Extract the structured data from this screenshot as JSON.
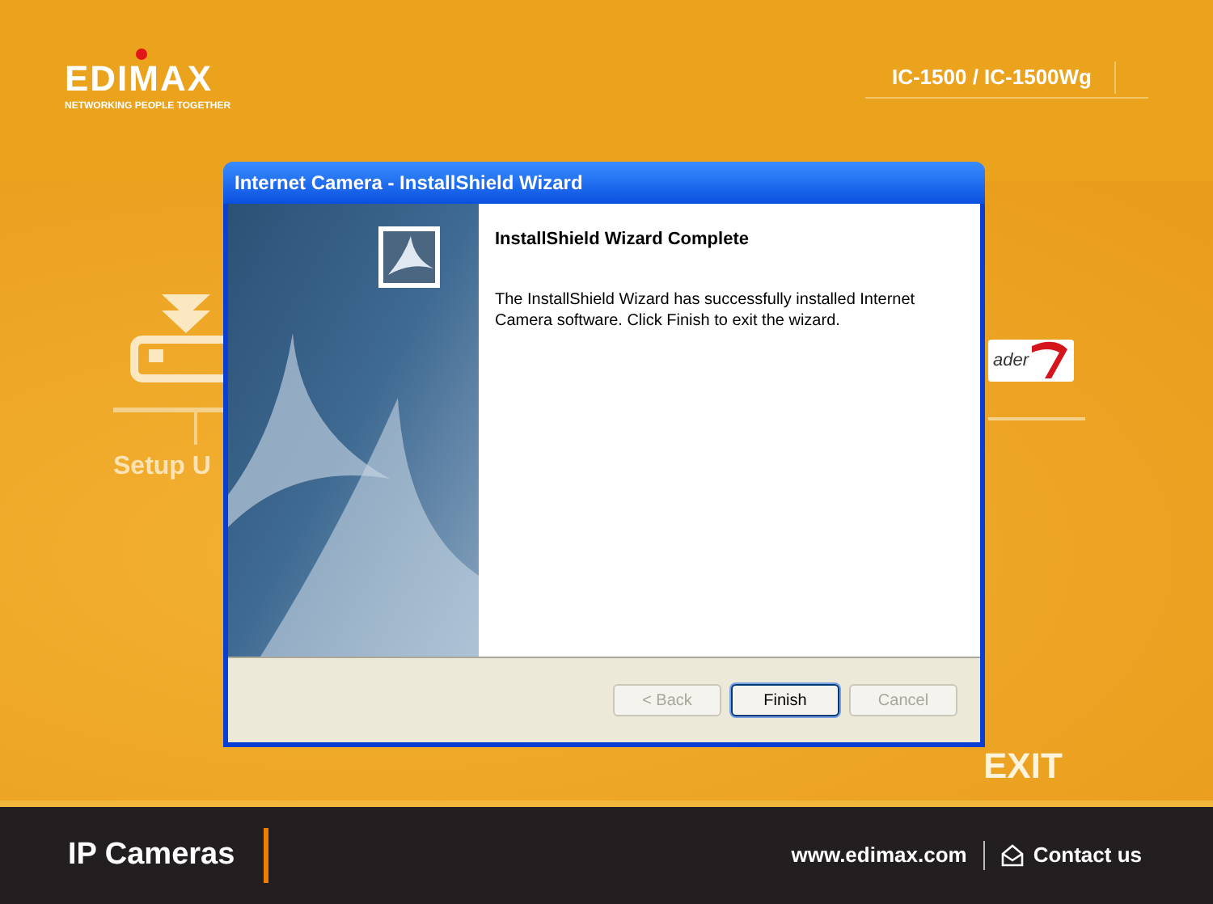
{
  "header": {
    "logo": "EDIMAX",
    "tagline": "NETWORKING PEOPLE TOGETHER",
    "model": "IC-1500 / IC-1500Wg"
  },
  "menu": [
    {
      "kind": "setup",
      "label": "Setup U"
    },
    {
      "kind": "reader",
      "label": "ader"
    },
    {
      "kind": "exit",
      "label": "EXIT"
    }
  ],
  "dialog": {
    "title": "Internet Camera - InstallShield Wizard",
    "heading": "InstallShield Wizard Complete",
    "message": "The InstallShield Wizard has successfully installed Internet Camera software. Click Finish to exit the wizard.",
    "buttons": [
      {
        "label": "< Back",
        "disabled": true,
        "default": false
      },
      {
        "label": "Finish",
        "disabled": false,
        "default": true
      },
      {
        "label": "Cancel",
        "disabled": true,
        "default": false
      }
    ]
  },
  "footer": {
    "title": "IP Cameras",
    "website": "www.edimax.com",
    "contact": "Contact us"
  }
}
